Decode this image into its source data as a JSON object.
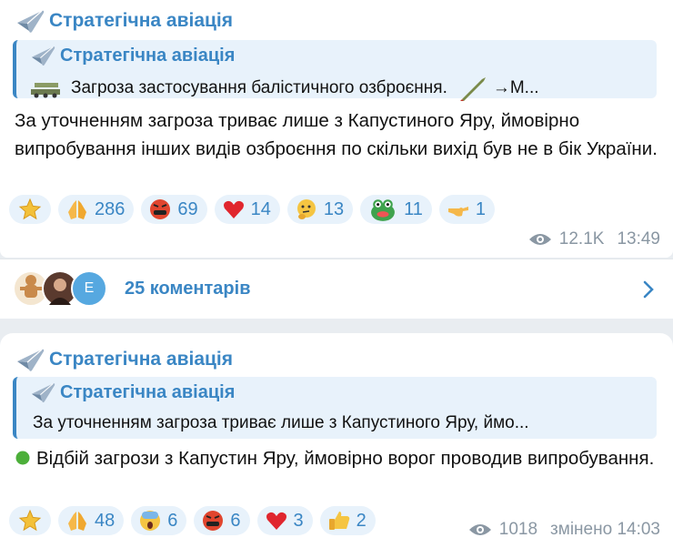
{
  "post1": {
    "channel": "Стратегічна авіація",
    "quote": {
      "channel": "Стратегічна авіація",
      "text": "Загроза застосування балістичного озброєння.",
      "text_tail": "→М..."
    },
    "body": "За уточненням загроза триває лише з Капустиного Яру, ймовірно випробування інших видів озброєння по скільки вихід був не в бік України.",
    "reactions": [
      {
        "icon": "star-icon",
        "count": ""
      },
      {
        "icon": "pray-icon",
        "count": "286"
      },
      {
        "icon": "angry-face-icon",
        "count": "69"
      },
      {
        "icon": "heart-icon",
        "count": "14"
      },
      {
        "icon": "thinking-face-icon",
        "count": "13"
      },
      {
        "icon": "frog-sticker-icon",
        "count": "11"
      },
      {
        "icon": "pointing-hand-icon",
        "count": "1"
      }
    ],
    "views": "12.1K",
    "time": "13:49"
  },
  "comments": {
    "label": "25 коментарів",
    "avatar_letter": "E"
  },
  "post2": {
    "channel": "Стратегічна авіація",
    "quote": {
      "channel": "Стратегічна авіація",
      "text": "За уточненням загроза триває лише з Капустиного Яру, ймо..."
    },
    "body": "Відбій загрози з Капустин Яру, ймовірно ворог проводив випробування.",
    "reactions": [
      {
        "icon": "star-icon",
        "count": ""
      },
      {
        "icon": "pray-icon",
        "count": "48"
      },
      {
        "icon": "screaming-face-icon",
        "count": "6"
      },
      {
        "icon": "angry-face-icon",
        "count": "6"
      },
      {
        "icon": "heart-icon",
        "count": "3"
      },
      {
        "icon": "thumbs-up-icon",
        "count": "2"
      }
    ],
    "views": "1018",
    "time": "змінено 14:03"
  },
  "colors": {
    "accent": "#3a86c4",
    "quote_bg": "#e8f2fb",
    "meta": "#8a97a3",
    "page_bg": "#e9edf1"
  }
}
